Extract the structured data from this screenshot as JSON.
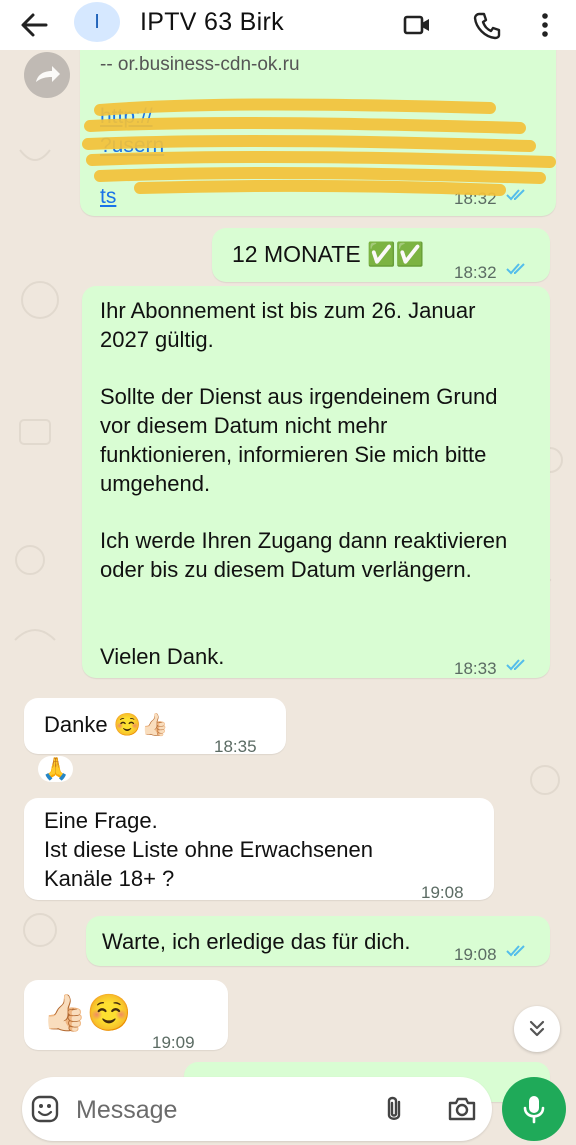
{
  "header": {
    "avatar_letter": "I",
    "contact_name": "IPTV 63 Birk"
  },
  "messages": {
    "link_snippet_top": "-- or.business-cdn-ok.ru",
    "link_line1": "http://",
    "link_line2": "?usern",
    "link_line3": "ts",
    "link_time": "18:32",
    "m12_text": "12 MONATE ✅✅",
    "m12_time": "18:32",
    "sub_p1": "Ihr Abonnement ist bis zum 26. Januar 2027 gültig.",
    "sub_p2": "Sollte der Dienst aus irgendeinem Grund vor diesem Datum nicht mehr funktionieren, informieren Sie mich bitte umgehend.",
    "sub_p3": "Ich werde Ihren Zugang dann reaktivieren oder bis zu diesem Datum verlängern.",
    "sub_p4": "Vielen Dank.",
    "sub_time": "18:33",
    "danke_text": "Danke ☺️👍🏻",
    "danke_time": "18:35",
    "reaction": "🙏",
    "frage_line1": "Eine Frage.",
    "frage_line2": "Ist diese Liste ohne Erwachsenen",
    "frage_line3": "Kanäle 18+ ?",
    "frage_time": "19:08",
    "warte_text": "Warte, ich erledige das für dich.",
    "warte_time": "19:08",
    "thumbs_text": "👍🏻☺️",
    "thumbs_time": "19:09"
  },
  "composer": {
    "placeholder": "Message"
  },
  "colors": {
    "outgoing": "#d9fdd3",
    "incoming": "#ffffff",
    "accent": "#1faa59",
    "ticks": "#53bdeb"
  },
  "icons": {
    "back": "arrow-left-icon",
    "video": "video-call-icon",
    "call": "phone-icon",
    "menu": "more-vert-icon",
    "emoji": "emoji-icon",
    "attach": "paperclip-icon",
    "camera": "camera-icon",
    "mic": "microphone-icon",
    "scroll": "chevrons-down-icon",
    "forward": "forward-icon"
  }
}
